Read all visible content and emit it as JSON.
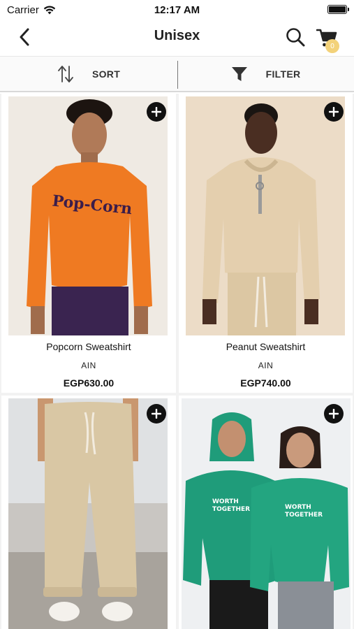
{
  "status": {
    "carrier": "Carrier",
    "time": "12:17 AM"
  },
  "nav": {
    "title": "Unisex",
    "cart_count": "0"
  },
  "toolbar": {
    "sort_label": "SORT",
    "filter_label": "FILTER"
  },
  "colors": {
    "accent_badge": "#f3d27a",
    "text": "#111111"
  },
  "products": [
    {
      "name": "Popcorn Sweatshirt",
      "brand": "AIN",
      "price": "EGP630.00",
      "image": "person in orange Pop-Corn sweatshirt",
      "garment_color": "#ef7a22"
    },
    {
      "name": "Peanut Sweatshirt",
      "brand": "AIN",
      "price": "EGP740.00",
      "image": "person in beige half-zip hoodie",
      "garment_color": "#e4cfae"
    },
    {
      "name": "",
      "brand": "",
      "price": "",
      "image": "beige drawstring sweatpants",
      "garment_color": "#d9c7a4"
    },
    {
      "name": "",
      "brand": "",
      "price": "",
      "image": "two people in green hoodies",
      "garment_color": "#1f9c7a"
    }
  ]
}
